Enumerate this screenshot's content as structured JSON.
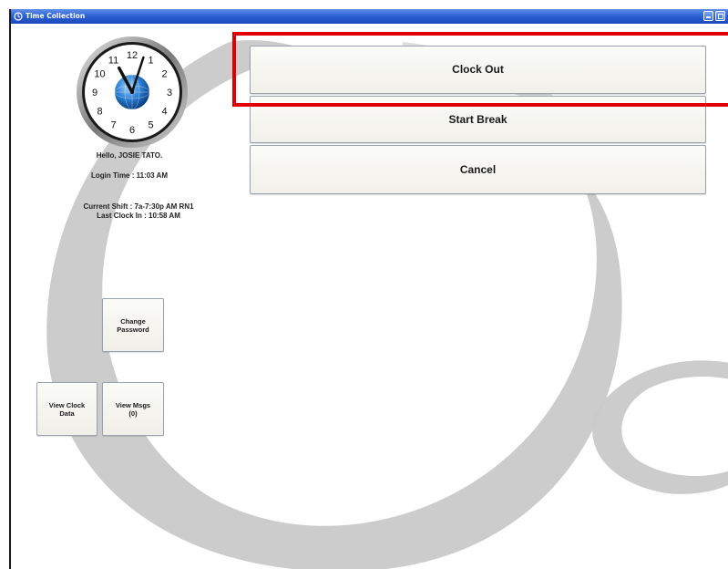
{
  "window": {
    "title": "Time Collection"
  },
  "user": {
    "greeting": "Hello,  JOSIE TATO.",
    "login_time": "Login Time : 11:03 AM",
    "current_shift": "Current Shift : 7a-7:30p AM RN1",
    "last_clock_in": "Last Clock In : 10:58 AM"
  },
  "clock": {
    "numbers": [
      "12",
      "1",
      "2",
      "3",
      "4",
      "5",
      "6",
      "7",
      "8",
      "9",
      "10",
      "11"
    ],
    "hour": 11,
    "minute": 3
  },
  "actions": {
    "clock_out": "Clock Out",
    "start_break": "Start Break",
    "cancel": "Cancel"
  },
  "side_buttons": {
    "change_password": "Change\nPassword",
    "view_clock_data": "View Clock\nData",
    "view_msgs": "View Msgs\n(0)"
  },
  "colors": {
    "highlight": "#e00000",
    "titlebar": "#2f62d6",
    "swoosh": "#c8c8c8"
  }
}
